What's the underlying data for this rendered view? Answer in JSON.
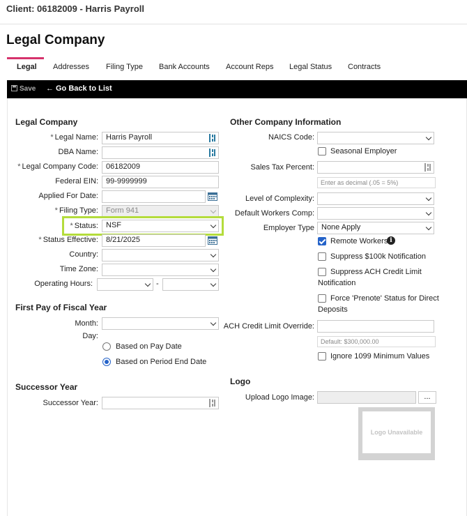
{
  "header": {
    "client": "Client: 06182009 - Harris Payroll",
    "title": "Legal Company"
  },
  "tabs": [
    "Legal",
    "Addresses",
    "Filing Type",
    "Bank Accounts",
    "Account Reps",
    "Legal Status",
    "Contracts"
  ],
  "toolbar": {
    "save": "Save",
    "back": "Go Back to List"
  },
  "legal": {
    "section": "Legal Company",
    "legal_name_label": "Legal Name:",
    "legal_name": "Harris Payroll",
    "dba_label": "DBA Name:",
    "dba": "",
    "code_label": "Legal Company Code:",
    "code": "06182009",
    "ein_label": "Federal EIN:",
    "ein": "99-9999999",
    "applied_label": "Applied For Date:",
    "applied": "",
    "filing_label": "Filing Type:",
    "filing": "Form 941",
    "status_label": "Status:",
    "status": "NSF",
    "status_eff_label": "Status Effective:",
    "status_eff": "8/21/2025",
    "country_label": "Country:",
    "country": "",
    "tz_label": "Time Zone:",
    "tz": "",
    "hours_label": "Operating Hours:",
    "hours_sep": "-"
  },
  "fiscal": {
    "section": "First Pay of Fiscal Year",
    "month_label": "Month:",
    "day_label": "Day:",
    "opt_pay": "Based on Pay Date",
    "opt_period": "Based on Period End Date",
    "selected": "Based on Period End Date"
  },
  "successor": {
    "section": "Successor Year",
    "label": "Successor Year:",
    "value": ""
  },
  "other": {
    "section": "Other Company Information",
    "naics_label": "NAICS Code:",
    "seasonal": "Seasonal Employer",
    "sales_tax_label": "Sales Tax Percent:",
    "sales_tax_hint": "Enter as decimal (.05 = 5%)",
    "complexity_label": "Level of Complexity:",
    "workers_comp_label": "Default Workers Comp:",
    "employer_type_label": "Employer Type",
    "employer_type": "None Apply",
    "remote": "Remote Workers",
    "suppress100k": "Suppress $100k Notification",
    "suppress_ach_1": "Suppress ACH Credit Limit",
    "suppress_ach_2": "Notification",
    "prenote_1": "Force 'Prenote' Status for Direct",
    "prenote_2": "Deposits",
    "ach_override_label": "ACH Credit Limit Override:",
    "ach_default": "Default: $300,000.00",
    "ignore1099": "Ignore 1099 Minimum Values"
  },
  "logo": {
    "section": "Logo",
    "upload_label": "Upload Logo Image:",
    "browse": "...",
    "placeholder": "Logo Unavailable"
  },
  "colors": {
    "tab_underline": "#d6336c",
    "highlight": "#b4dc3c",
    "checkbox": "#2563c9"
  }
}
